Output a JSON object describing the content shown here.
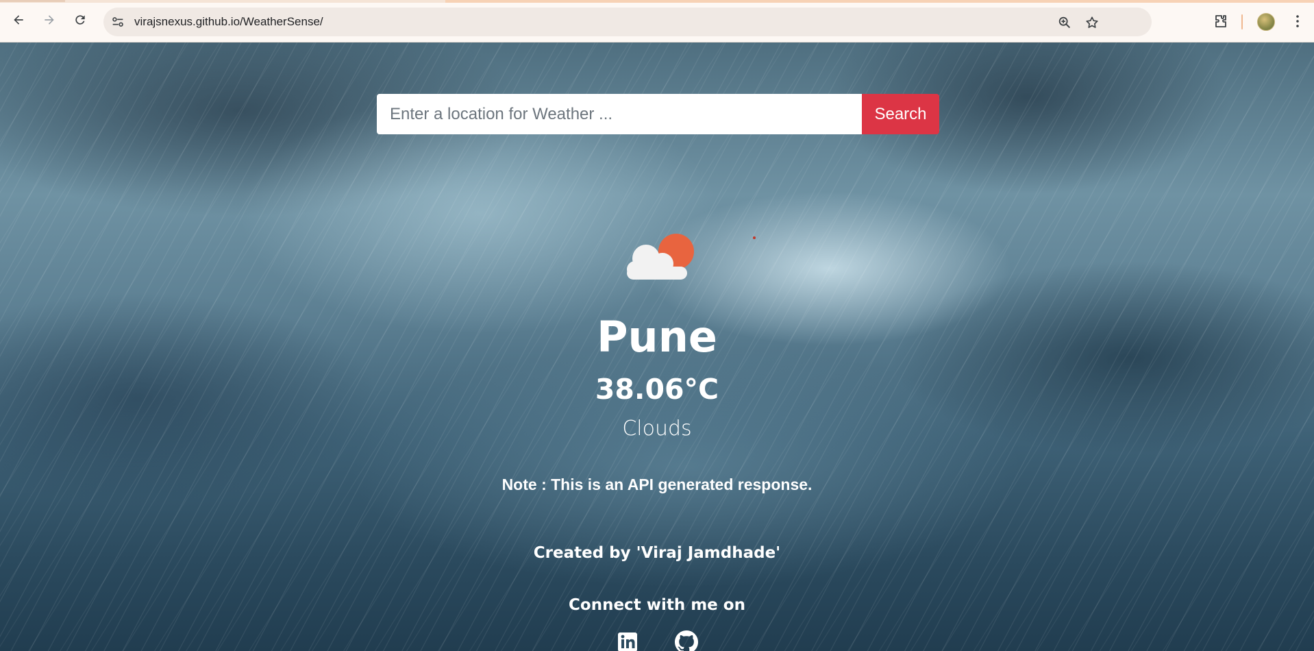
{
  "browser": {
    "url": "virajsnexus.github.io/WeatherSense/"
  },
  "search": {
    "placeholder": "Enter a location for Weather ...",
    "button_label": "Search"
  },
  "weather": {
    "icon": "cloud-sun-icon",
    "city": "Pune",
    "temperature": "38.06°C",
    "condition": "Clouds"
  },
  "note": "Note : This is an API generated response.",
  "footer": {
    "credit": "Created by 'Viraj Jamdhade'",
    "connect": "Connect with me on",
    "social": [
      "linkedin-icon",
      "github-icon"
    ]
  },
  "colors": {
    "search_button": "#dc3545",
    "sun": "#e8643f"
  }
}
